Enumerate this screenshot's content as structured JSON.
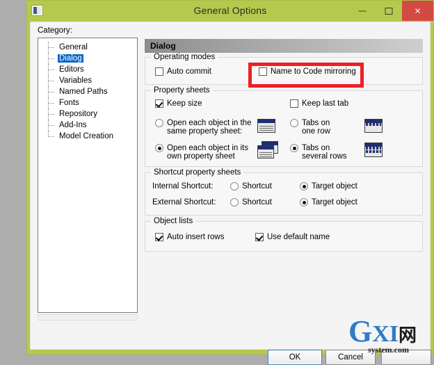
{
  "window": {
    "title": "General Options",
    "icon": "application-icon",
    "buttons": {
      "minimize": "–",
      "maximize": "□",
      "close": "×"
    }
  },
  "category": {
    "label": "Category:",
    "items": [
      {
        "label": "General",
        "selected": false
      },
      {
        "label": "Dialog",
        "selected": true
      },
      {
        "label": "Editors",
        "selected": false
      },
      {
        "label": "Variables",
        "selected": false
      },
      {
        "label": "Named Paths",
        "selected": false
      },
      {
        "label": "Fonts",
        "selected": false
      },
      {
        "label": "Repository",
        "selected": false
      },
      {
        "label": "Add-Ins",
        "selected": false
      },
      {
        "label": "Model Creation",
        "selected": false
      }
    ]
  },
  "pane": {
    "header": "Dialog",
    "operating_modes": {
      "title": "Operating modes",
      "auto_commit": {
        "label": "Auto commit",
        "checked": false
      },
      "name_to_code_mirroring": {
        "label": "Name to Code mirroring",
        "checked": false,
        "highlight_color": "#ec2024"
      }
    },
    "property_sheets": {
      "title": "Property sheets",
      "keep_size": {
        "label": "Keep size",
        "checked": true
      },
      "keep_last_tab": {
        "label": "Keep last tab",
        "checked": false
      },
      "open_same": {
        "label_line1": "Open each object in the",
        "label_line2": "same property sheet:",
        "selected": false
      },
      "open_own": {
        "label_line1": "Open each object in its",
        "label_line2": "own property sheet",
        "selected": true
      },
      "tabs_one_row": {
        "label_line1": "Tabs on",
        "label_line2": "one row",
        "selected": false
      },
      "tabs_several_rows": {
        "label_line1": "Tabs on",
        "label_line2": "several rows",
        "selected": true
      }
    },
    "shortcut_property_sheets": {
      "title": "Shortcut property sheets",
      "internal_label": "Internal Shortcut:",
      "external_label": "External Shortcut:",
      "internal_shortcut": {
        "label": "Shortcut",
        "selected": false
      },
      "internal_target": {
        "label": "Target object",
        "selected": true
      },
      "external_shortcut": {
        "label": "Shortcut",
        "selected": false
      },
      "external_target": {
        "label": "Target object",
        "selected": true
      }
    },
    "object_lists": {
      "title": "Object lists",
      "auto_insert_rows": {
        "label": "Auto insert rows",
        "checked": true
      },
      "use_default_name": {
        "label": "Use default name",
        "checked": true
      }
    }
  },
  "footer": {
    "ok": "OK",
    "cancel": "Cancel",
    "third": ""
  },
  "watermark": {
    "g": "G",
    "xi": "XI",
    "cn": "网",
    "sub": "system.com"
  }
}
